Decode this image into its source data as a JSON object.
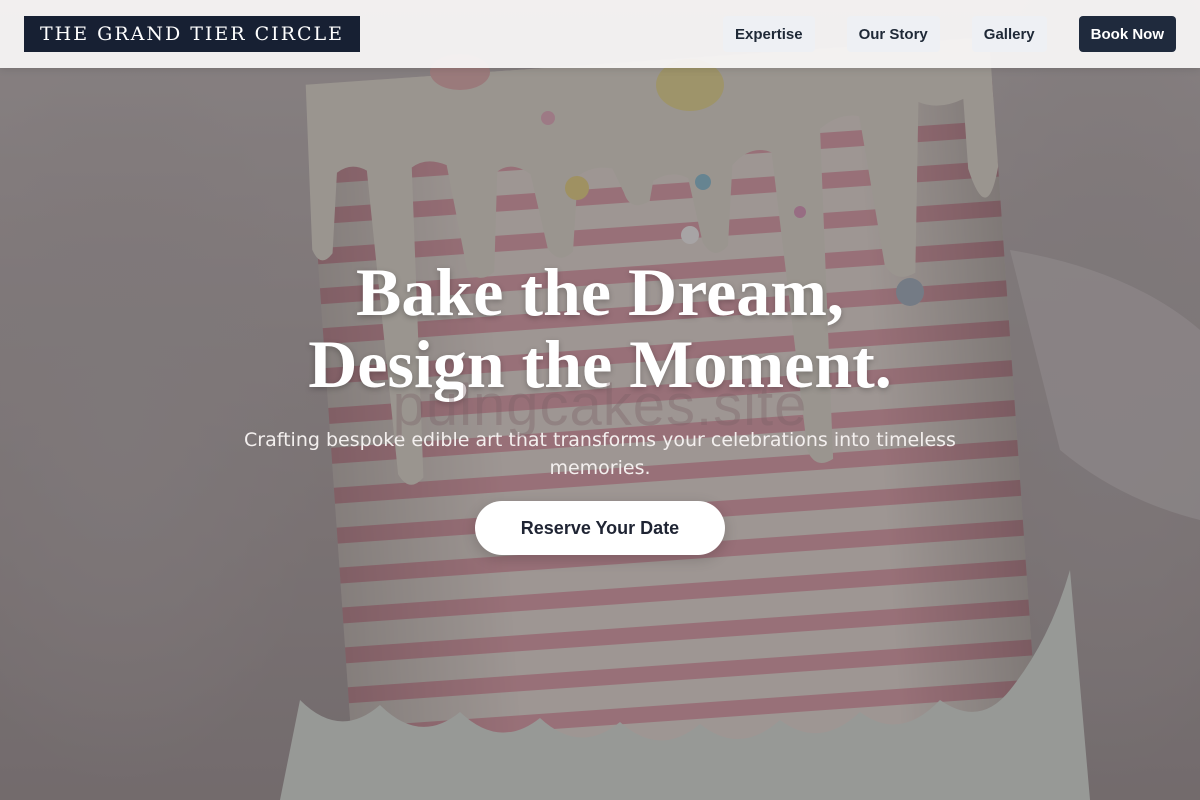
{
  "header": {
    "logo_text": "THE GRAND TIER CIRCLE",
    "nav": [
      {
        "label": "Expertise"
      },
      {
        "label": "Our Story"
      },
      {
        "label": "Gallery"
      }
    ],
    "cta_label": "Book Now"
  },
  "hero": {
    "title_line1": "Bake the Dream,",
    "title_line2": "Design the Moment.",
    "subtitle": "Crafting bespoke edible art that transforms your celebrations into timeless memories.",
    "button_label": "Reserve Your Date",
    "watermark_text": "pulngcakes.site"
  },
  "colors": {
    "navy": "#172033",
    "button_navy": "#1f2a3d",
    "cake_pink": "#e9a9b3",
    "cake_cream": "#f1ebe3"
  }
}
